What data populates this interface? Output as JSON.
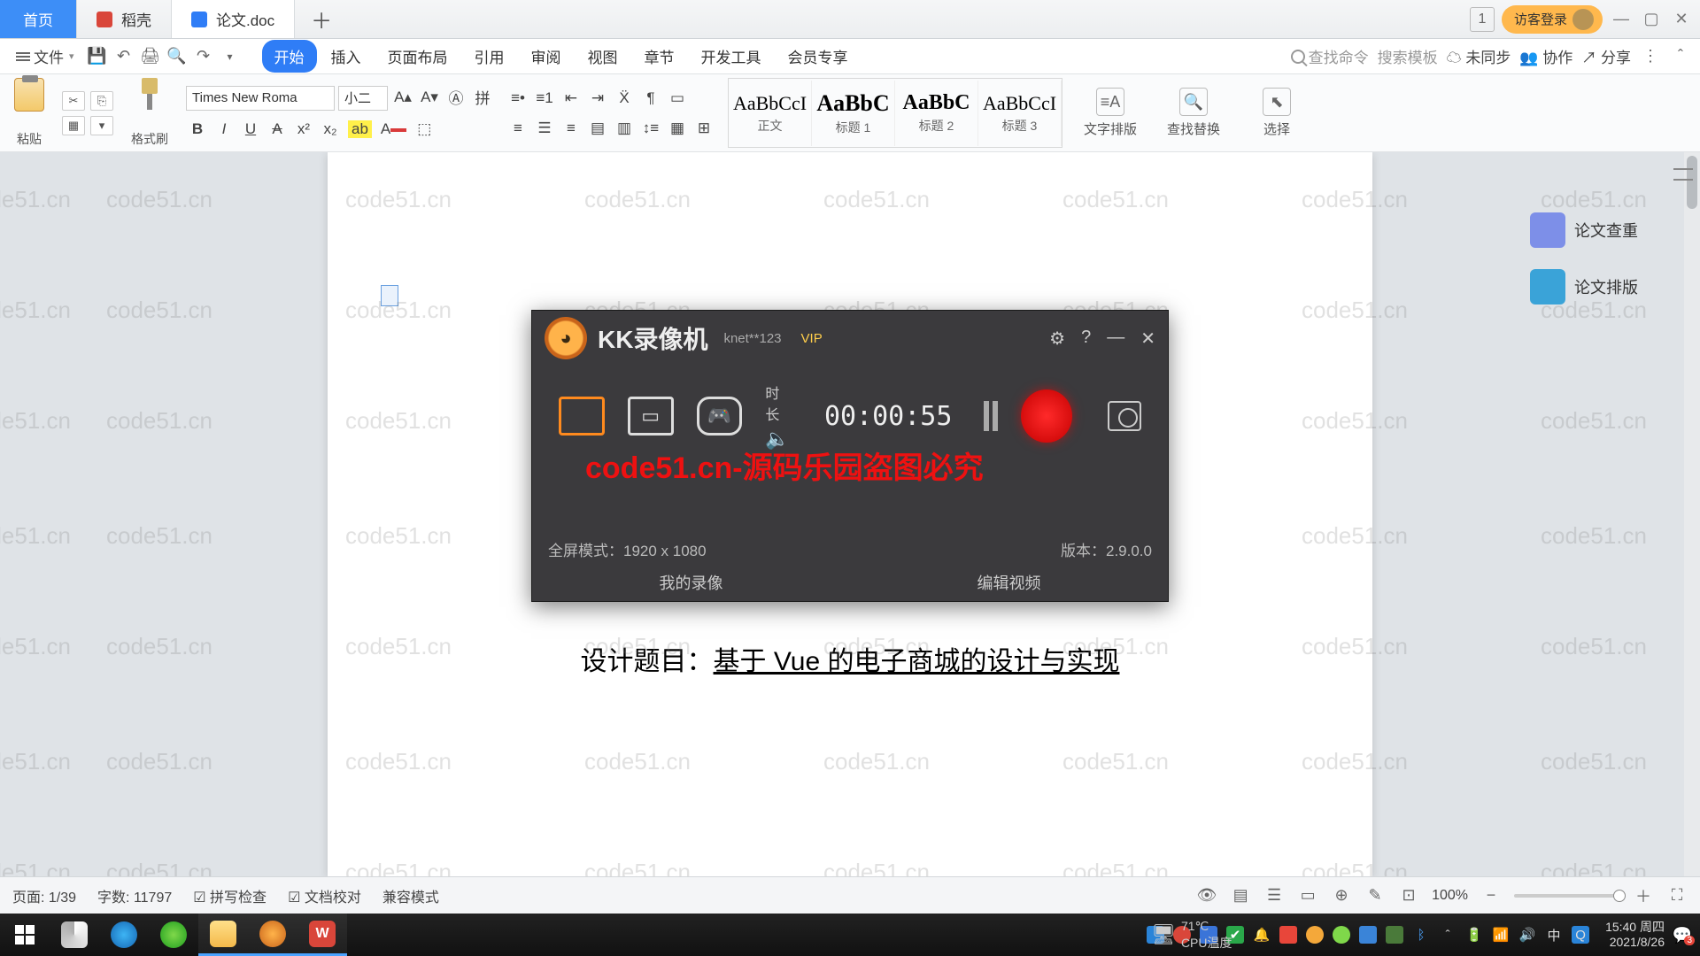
{
  "tabs": {
    "home": "首页",
    "t1": {
      "label": "稻壳",
      "iconColor": "#d9463a"
    },
    "t2": {
      "label": "论文.doc",
      "iconColor": "#2f7df6"
    }
  },
  "titlebar": {
    "badge": "1",
    "login": "访客登录"
  },
  "menubar": {
    "file": "文件",
    "tabs": [
      "开始",
      "插入",
      "页面布局",
      "引用",
      "审阅",
      "视图",
      "章节",
      "开发工具",
      "会员专享"
    ],
    "searchPlaceholder": "查找命令",
    "searchTemplate": "搜索模板",
    "unsync": "未同步",
    "collab": "协作",
    "share": "分享"
  },
  "toolbar": {
    "paste": "粘贴",
    "brush": "格式刷",
    "fontName": "Times New Roma",
    "fontSize": "小二",
    "bold": "B",
    "italic": "I",
    "underline": "U",
    "styles": [
      {
        "preview": "AaBbCcI",
        "name": "正文"
      },
      {
        "preview": "AaBbC",
        "name": "标题 1"
      },
      {
        "preview": "AaBbC",
        "name": "标题 2"
      },
      {
        "preview": "AaBbCcI",
        "name": "标题 3"
      }
    ],
    "toolsRight": [
      "文字排版",
      "查找替换",
      "选择"
    ]
  },
  "sidepanel": {
    "items": [
      {
        "label": "论文查重",
        "color": "#7d8fe8"
      },
      {
        "label": "论文排版",
        "color": "#3aa3d8"
      }
    ]
  },
  "document": {
    "titlePrefix": "设计题目：",
    "titleUnderlined": "基于 Vue 的电子商城的设计与实现"
  },
  "kk": {
    "title": "KK录像机",
    "user": "knet**123",
    "vip": "VIP",
    "settings": "⚙",
    "timerLabel": "时长",
    "timer": "00:00:55",
    "resLabel": "全屏模式：",
    "resolution": "1920 x 1080",
    "verLabel": "版本：",
    "version": "2.9.0.0",
    "myRec": "我的录像",
    "editVideo": "编辑视频",
    "watermark": "code51.cn-源码乐园盗图必究"
  },
  "statusbar": {
    "page": "页面: 1/39",
    "words": "字数: 11797",
    "spell": "拼写检查",
    "proof": "文档校对",
    "compat": "兼容模式",
    "zoom": "100%"
  },
  "taskbar": {
    "cpuLabel": "CPU温度",
    "temp": "71℃",
    "ime": "中",
    "time": "15:40",
    "day": "周四",
    "date": "2021/8/26",
    "notif": "3"
  },
  "watermarkText": "code51.cn"
}
